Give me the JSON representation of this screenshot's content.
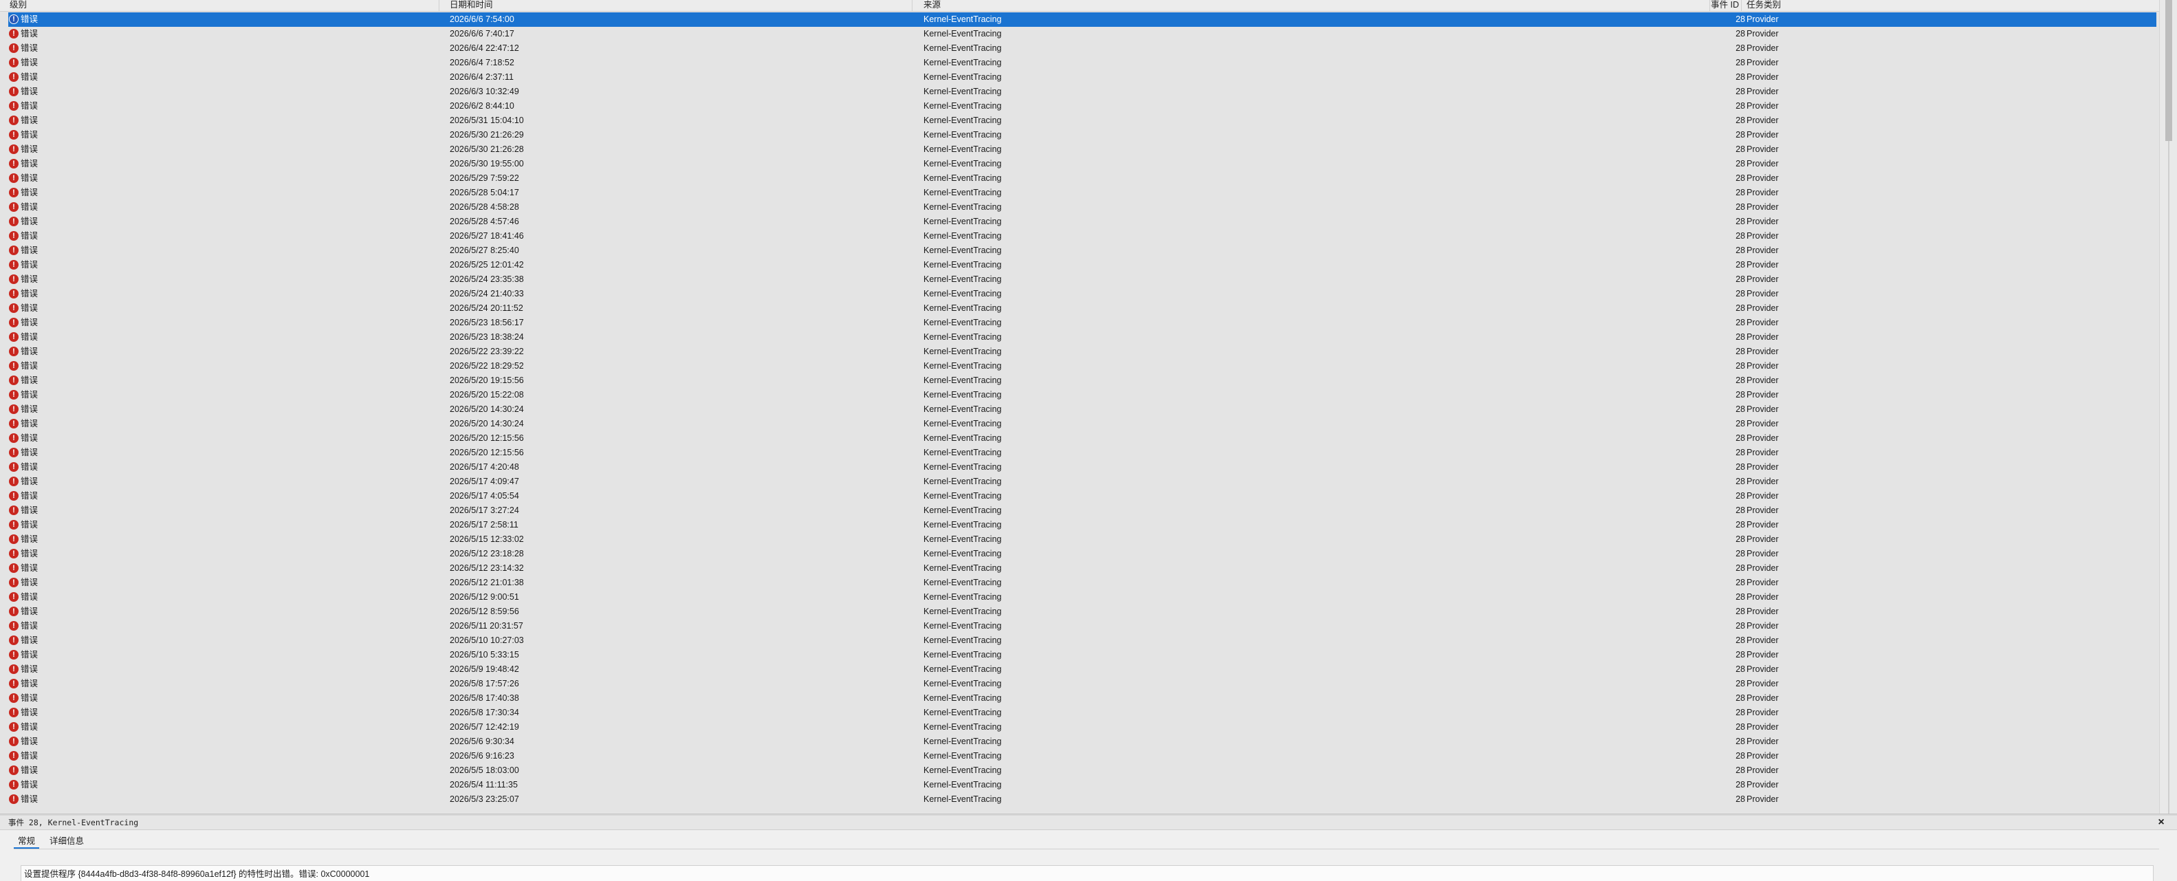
{
  "table": {
    "columns": {
      "level": "级别",
      "datetime": "日期和时间",
      "source": "来源",
      "event_id": "事件 ID",
      "task_category": "任务类别"
    },
    "rows": [
      {
        "level": "错误",
        "datetime": "2026/6/6 7:54:00",
        "source": "Kernel-EventTracing",
        "event_id": "28",
        "task_category": "Provider",
        "selected": true
      },
      {
        "level": "错误",
        "datetime": "2026/6/6 7:40:17",
        "source": "Kernel-EventTracing",
        "event_id": "28",
        "task_category": "Provider"
      },
      {
        "level": "错误",
        "datetime": "2026/6/4 22:47:12",
        "source": "Kernel-EventTracing",
        "event_id": "28",
        "task_category": "Provider"
      },
      {
        "level": "错误",
        "datetime": "2026/6/4 7:18:52",
        "source": "Kernel-EventTracing",
        "event_id": "28",
        "task_category": "Provider"
      },
      {
        "level": "错误",
        "datetime": "2026/6/4 2:37:11",
        "source": "Kernel-EventTracing",
        "event_id": "28",
        "task_category": "Provider"
      },
      {
        "level": "错误",
        "datetime": "2026/6/3 10:32:49",
        "source": "Kernel-EventTracing",
        "event_id": "28",
        "task_category": "Provider"
      },
      {
        "level": "错误",
        "datetime": "2026/6/2 8:44:10",
        "source": "Kernel-EventTracing",
        "event_id": "28",
        "task_category": "Provider"
      },
      {
        "level": "错误",
        "datetime": "2026/5/31 15:04:10",
        "source": "Kernel-EventTracing",
        "event_id": "28",
        "task_category": "Provider"
      },
      {
        "level": "错误",
        "datetime": "2026/5/30 21:26:29",
        "source": "Kernel-EventTracing",
        "event_id": "28",
        "task_category": "Provider"
      },
      {
        "level": "错误",
        "datetime": "2026/5/30 21:26:28",
        "source": "Kernel-EventTracing",
        "event_id": "28",
        "task_category": "Provider"
      },
      {
        "level": "错误",
        "datetime": "2026/5/30 19:55:00",
        "source": "Kernel-EventTracing",
        "event_id": "28",
        "task_category": "Provider"
      },
      {
        "level": "错误",
        "datetime": "2026/5/29 7:59:22",
        "source": "Kernel-EventTracing",
        "event_id": "28",
        "task_category": "Provider"
      },
      {
        "level": "错误",
        "datetime": "2026/5/28 5:04:17",
        "source": "Kernel-EventTracing",
        "event_id": "28",
        "task_category": "Provider"
      },
      {
        "level": "错误",
        "datetime": "2026/5/28 4:58:28",
        "source": "Kernel-EventTracing",
        "event_id": "28",
        "task_category": "Provider"
      },
      {
        "level": "错误",
        "datetime": "2026/5/28 4:57:46",
        "source": "Kernel-EventTracing",
        "event_id": "28",
        "task_category": "Provider"
      },
      {
        "level": "错误",
        "datetime": "2026/5/27 18:41:46",
        "source": "Kernel-EventTracing",
        "event_id": "28",
        "task_category": "Provider"
      },
      {
        "level": "错误",
        "datetime": "2026/5/27 8:25:40",
        "source": "Kernel-EventTracing",
        "event_id": "28",
        "task_category": "Provider"
      },
      {
        "level": "错误",
        "datetime": "2026/5/25 12:01:42",
        "source": "Kernel-EventTracing",
        "event_id": "28",
        "task_category": "Provider"
      },
      {
        "level": "错误",
        "datetime": "2026/5/24 23:35:38",
        "source": "Kernel-EventTracing",
        "event_id": "28",
        "task_category": "Provider"
      },
      {
        "level": "错误",
        "datetime": "2026/5/24 21:40:33",
        "source": "Kernel-EventTracing",
        "event_id": "28",
        "task_category": "Provider"
      },
      {
        "level": "错误",
        "datetime": "2026/5/24 20:11:52",
        "source": "Kernel-EventTracing",
        "event_id": "28",
        "task_category": "Provider"
      },
      {
        "level": "错误",
        "datetime": "2026/5/23 18:56:17",
        "source": "Kernel-EventTracing",
        "event_id": "28",
        "task_category": "Provider"
      },
      {
        "level": "错误",
        "datetime": "2026/5/23 18:38:24",
        "source": "Kernel-EventTracing",
        "event_id": "28",
        "task_category": "Provider"
      },
      {
        "level": "错误",
        "datetime": "2026/5/22 23:39:22",
        "source": "Kernel-EventTracing",
        "event_id": "28",
        "task_category": "Provider"
      },
      {
        "level": "错误",
        "datetime": "2026/5/22 18:29:52",
        "source": "Kernel-EventTracing",
        "event_id": "28",
        "task_category": "Provider"
      },
      {
        "level": "错误",
        "datetime": "2026/5/20 19:15:56",
        "source": "Kernel-EventTracing",
        "event_id": "28",
        "task_category": "Provider"
      },
      {
        "level": "错误",
        "datetime": "2026/5/20 15:22:08",
        "source": "Kernel-EventTracing",
        "event_id": "28",
        "task_category": "Provider"
      },
      {
        "level": "错误",
        "datetime": "2026/5/20 14:30:24",
        "source": "Kernel-EventTracing",
        "event_id": "28",
        "task_category": "Provider"
      },
      {
        "level": "错误",
        "datetime": "2026/5/20 14:30:24",
        "source": "Kernel-EventTracing",
        "event_id": "28",
        "task_category": "Provider"
      },
      {
        "level": "错误",
        "datetime": "2026/5/20 12:15:56",
        "source": "Kernel-EventTracing",
        "event_id": "28",
        "task_category": "Provider"
      },
      {
        "level": "错误",
        "datetime": "2026/5/20 12:15:56",
        "source": "Kernel-EventTracing",
        "event_id": "28",
        "task_category": "Provider"
      },
      {
        "level": "错误",
        "datetime": "2026/5/17 4:20:48",
        "source": "Kernel-EventTracing",
        "event_id": "28",
        "task_category": "Provider"
      },
      {
        "level": "错误",
        "datetime": "2026/5/17 4:09:47",
        "source": "Kernel-EventTracing",
        "event_id": "28",
        "task_category": "Provider"
      },
      {
        "level": "错误",
        "datetime": "2026/5/17 4:05:54",
        "source": "Kernel-EventTracing",
        "event_id": "28",
        "task_category": "Provider"
      },
      {
        "level": "错误",
        "datetime": "2026/5/17 3:27:24",
        "source": "Kernel-EventTracing",
        "event_id": "28",
        "task_category": "Provider"
      },
      {
        "level": "错误",
        "datetime": "2026/5/17 2:58:11",
        "source": "Kernel-EventTracing",
        "event_id": "28",
        "task_category": "Provider"
      },
      {
        "level": "错误",
        "datetime": "2026/5/15 12:33:02",
        "source": "Kernel-EventTracing",
        "event_id": "28",
        "task_category": "Provider"
      },
      {
        "level": "错误",
        "datetime": "2026/5/12 23:18:28",
        "source": "Kernel-EventTracing",
        "event_id": "28",
        "task_category": "Provider"
      },
      {
        "level": "错误",
        "datetime": "2026/5/12 23:14:32",
        "source": "Kernel-EventTracing",
        "event_id": "28",
        "task_category": "Provider"
      },
      {
        "level": "错误",
        "datetime": "2026/5/12 21:01:38",
        "source": "Kernel-EventTracing",
        "event_id": "28",
        "task_category": "Provider"
      },
      {
        "level": "错误",
        "datetime": "2026/5/12 9:00:51",
        "source": "Kernel-EventTracing",
        "event_id": "28",
        "task_category": "Provider"
      },
      {
        "level": "错误",
        "datetime": "2026/5/12 8:59:56",
        "source": "Kernel-EventTracing",
        "event_id": "28",
        "task_category": "Provider"
      },
      {
        "level": "错误",
        "datetime": "2026/5/11 20:31:57",
        "source": "Kernel-EventTracing",
        "event_id": "28",
        "task_category": "Provider"
      },
      {
        "level": "错误",
        "datetime": "2026/5/10 10:27:03",
        "source": "Kernel-EventTracing",
        "event_id": "28",
        "task_category": "Provider"
      },
      {
        "level": "错误",
        "datetime": "2026/5/10 5:33:15",
        "source": "Kernel-EventTracing",
        "event_id": "28",
        "task_category": "Provider"
      },
      {
        "level": "错误",
        "datetime": "2026/5/9 19:48:42",
        "source": "Kernel-EventTracing",
        "event_id": "28",
        "task_category": "Provider"
      },
      {
        "level": "错误",
        "datetime": "2026/5/8 17:57:26",
        "source": "Kernel-EventTracing",
        "event_id": "28",
        "task_category": "Provider"
      },
      {
        "level": "错误",
        "datetime": "2026/5/8 17:40:38",
        "source": "Kernel-EventTracing",
        "event_id": "28",
        "task_category": "Provider"
      },
      {
        "level": "错误",
        "datetime": "2026/5/8 17:30:34",
        "source": "Kernel-EventTracing",
        "event_id": "28",
        "task_category": "Provider"
      },
      {
        "level": "错误",
        "datetime": "2026/5/7 12:42:19",
        "source": "Kernel-EventTracing",
        "event_id": "28",
        "task_category": "Provider"
      },
      {
        "level": "错误",
        "datetime": "2026/5/6 9:30:34",
        "source": "Kernel-EventTracing",
        "event_id": "28",
        "task_category": "Provider"
      },
      {
        "level": "错误",
        "datetime": "2026/5/6 9:16:23",
        "source": "Kernel-EventTracing",
        "event_id": "28",
        "task_category": "Provider"
      },
      {
        "level": "错误",
        "datetime": "2026/5/5 18:03:00",
        "source": "Kernel-EventTracing",
        "event_id": "28",
        "task_category": "Provider"
      },
      {
        "level": "错误",
        "datetime": "2026/5/4 11:11:35",
        "source": "Kernel-EventTracing",
        "event_id": "28",
        "task_category": "Provider"
      },
      {
        "level": "错误",
        "datetime": "2026/5/3 23:25:07",
        "source": "Kernel-EventTracing",
        "event_id": "28",
        "task_category": "Provider"
      }
    ]
  },
  "detail": {
    "title": "事件 28, Kernel-EventTracing",
    "close_glyph": "×",
    "tabs": [
      "常规",
      "详细信息"
    ],
    "message": "设置提供程序 {8444a4fb-d8d3-4f38-84f8-89960a1ef12f} 的特性时出错。错误: 0xC0000001"
  },
  "icons": {
    "error": "error-icon",
    "close": "close-icon"
  },
  "colors": {
    "selection": "#1a73d1",
    "error_icon": "#c8271f"
  }
}
